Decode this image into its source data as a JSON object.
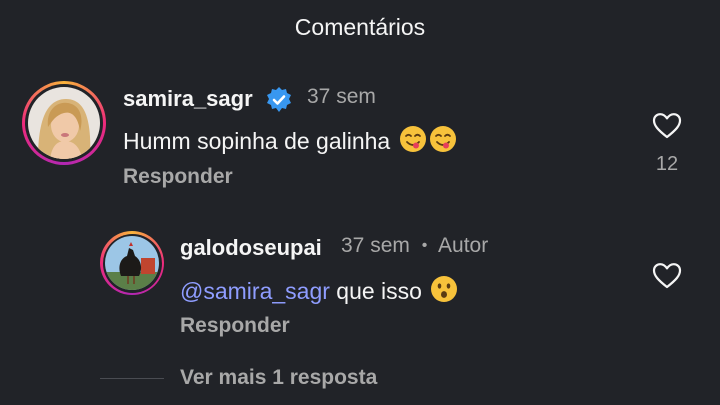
{
  "header": {
    "title": "Comentários"
  },
  "comments": [
    {
      "username": "samira_sagr",
      "verified": true,
      "time": "37 sem",
      "text": "Humm sopinha de galinha",
      "emojis": [
        "yum-face",
        "yum-face"
      ],
      "reply_label": "Responder",
      "likes": "12"
    }
  ],
  "replies": [
    {
      "username": "galodoseupai",
      "time": "37 sem",
      "separator": "•",
      "author_tag": "Autor",
      "mention": "@samira_sagr",
      "text": " que isso",
      "emojis": [
        "hushed-face"
      ],
      "reply_label": "Responder"
    }
  ],
  "view_more": {
    "label": "Ver mais 1 resposta"
  },
  "colors": {
    "background": "#212328",
    "muted": "#a8a8a8",
    "mention": "#8f9dff",
    "verified": "#3897f0"
  }
}
